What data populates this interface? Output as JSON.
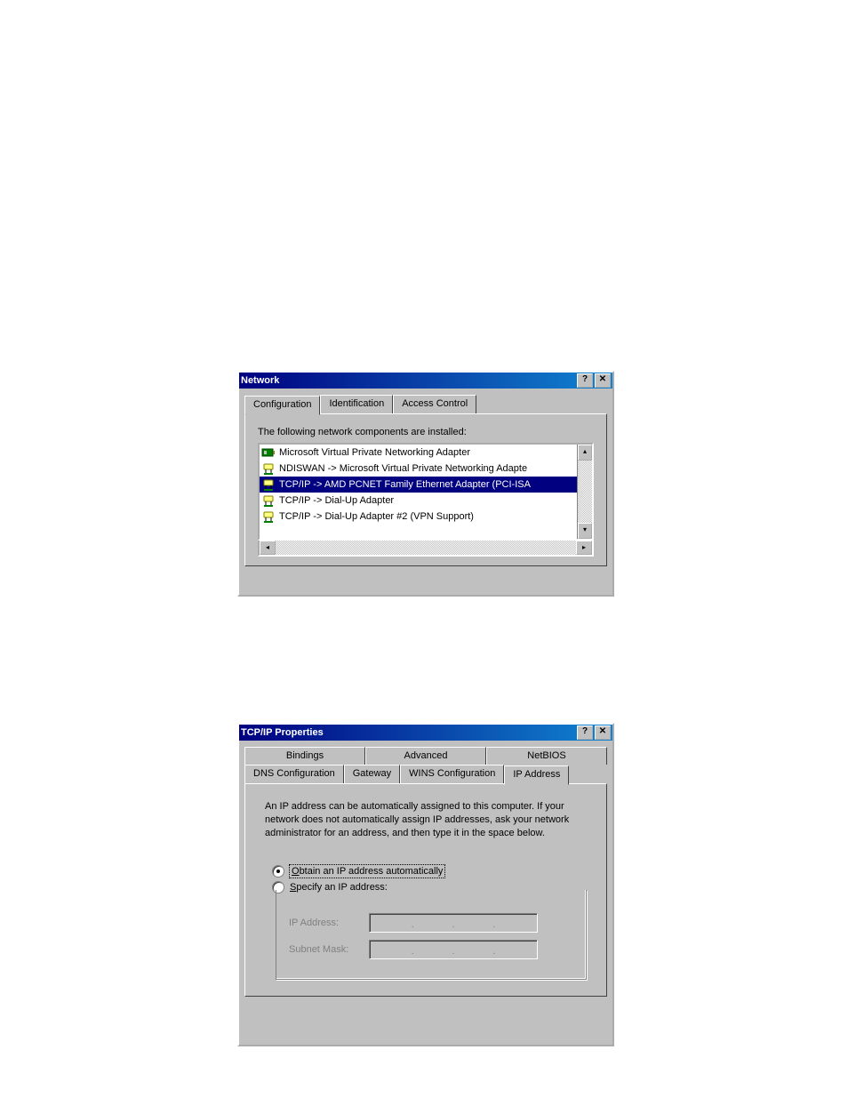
{
  "window1": {
    "title": "Network",
    "tabs": [
      "Configuration",
      "Identification",
      "Access Control"
    ],
    "helptext": "The following network components are installed:",
    "helptext_ak": "n",
    "items": [
      {
        "label": "Microsoft Virtual Private Networking Adapter",
        "icon": "adapter-card-icon",
        "selected": false
      },
      {
        "label": "NDISWAN -> Microsoft Virtual Private Networking Adapte",
        "icon": "protocol-binding-icon",
        "selected": false
      },
      {
        "label": "TCP/IP -> AMD PCNET Family Ethernet Adapter (PCI-ISA",
        "icon": "protocol-binding-icon",
        "selected": true
      },
      {
        "label": "TCP/IP -> Dial-Up Adapter",
        "icon": "protocol-binding-icon",
        "selected": false
      },
      {
        "label": "TCP/IP -> Dial-Up Adapter #2 (VPN Support)",
        "icon": "protocol-binding-icon",
        "selected": false
      }
    ]
  },
  "window2": {
    "title": "TCP/IP Properties",
    "tabs_row1": [
      "Bindings",
      "Advanced",
      "NetBIOS"
    ],
    "tabs_row2": [
      "DNS Configuration",
      "Gateway",
      "WINS Configuration",
      "IP Address"
    ],
    "active_tab": "IP Address",
    "blurb": "An IP address can be automatically assigned to this computer. If your network does not automatically assign IP addresses, ask your network administrator for an address, and then type it in the space below.",
    "radio1_leading": "O",
    "radio1": "btain an IP address automatically",
    "radio2_leading": "S",
    "radio2": "pecify an IP address:",
    "field1": "IP Address:",
    "field2": "Subnet Mask:",
    "ip_sep": "."
  }
}
